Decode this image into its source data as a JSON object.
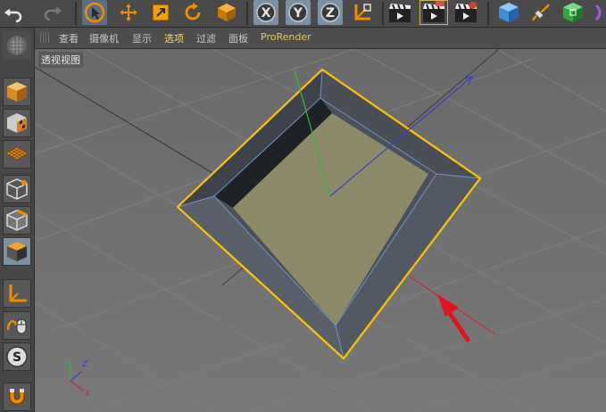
{
  "menu": {
    "items": [
      "查看",
      "摄像机",
      "显示",
      "选项",
      "过滤",
      "面板",
      "ProRender"
    ],
    "active_index": 3
  },
  "viewport": {
    "label": "透视视图"
  },
  "axis_gizmo": {
    "y": "Y",
    "z": "Z",
    "x": "X"
  },
  "toolbar": {
    "axis_x": "X",
    "axis_y": "Y",
    "axis_z": "Z"
  },
  "side": {
    "snap_label": "S"
  },
  "colors": {
    "selection_outline": "#ffc400",
    "inner_floor": "#8c8a68",
    "axis_x": "#c8283c",
    "axis_y": "#3cb43c",
    "axis_z": "#3c3cc8",
    "arrow": "#e0141e"
  },
  "icons": {
    "toolbar": [
      "undo-icon",
      "redo-icon",
      "live-select-icon",
      "move-icon",
      "scale-icon",
      "rotate-icon",
      "last-tool-icon",
      "x-axis-lock-icon",
      "y-axis-lock-icon",
      "z-axis-lock-icon",
      "coordinate-system-icon",
      "render-view-icon",
      "render-picture-viewer-icon",
      "edit-render-settings-icon",
      "cube-icon",
      "pen-icon",
      "subdivision-icon"
    ],
    "side": [
      "make-editable-icon",
      "model-mode-icon",
      "texture-mode-icon",
      "workplane-icon",
      "points-mode-icon",
      "edges-mode-icon",
      "polygons-mode-icon",
      "axis-mode-icon",
      "tweak-mode-icon",
      "snap-icon",
      "magnet-icon"
    ]
  }
}
